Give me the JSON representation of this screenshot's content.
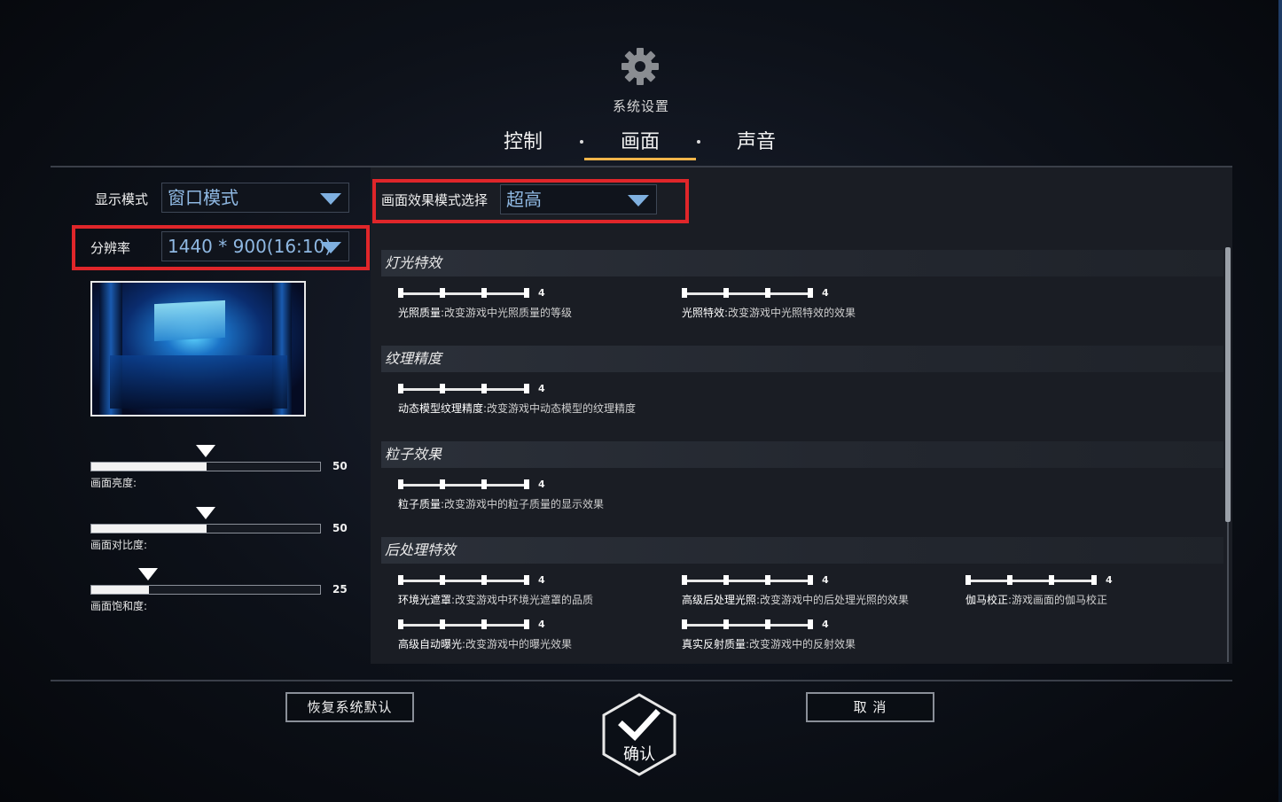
{
  "header": {
    "icon": "gear-icon",
    "title": "系统设置",
    "tabs": [
      {
        "label": "控制",
        "active": false
      },
      {
        "label": "画面",
        "active": true
      },
      {
        "label": "声音",
        "active": false
      }
    ],
    "accent_color": "#f1b54a"
  },
  "left": {
    "display_mode": {
      "label": "显示模式",
      "value": "窗口模式"
    },
    "resolution": {
      "label": "分辨率",
      "value": "1440 * 900(16:10)"
    },
    "sliders": [
      {
        "label": "画面亮度:",
        "value": "50",
        "fraction": 0.5
      },
      {
        "label": "画面对比度:",
        "value": "50",
        "fraction": 0.5
      },
      {
        "label": "画面饱和度:",
        "value": "25",
        "fraction": 0.25
      }
    ]
  },
  "right": {
    "quality_mode": {
      "label": "画面效果模式选择",
      "value": "超高"
    },
    "sections": [
      {
        "title": "灯光特效",
        "settings": [
          {
            "value": "4",
            "name": "光照质量",
            "desc": ":改变游戏中光照质量的等级"
          },
          {
            "value": "4",
            "name": "光照特效",
            "desc": ":改变游戏中光照特效的效果"
          }
        ]
      },
      {
        "title": "纹理精度",
        "settings": [
          {
            "value": "4",
            "name": "动态模型纹理精度",
            "desc": ":改变游戏中动态模型的纹理精度"
          }
        ]
      },
      {
        "title": "粒子效果",
        "settings": [
          {
            "value": "4",
            "name": "粒子质量",
            "desc": ":改变游戏中的粒子质量的显示效果"
          }
        ]
      },
      {
        "title": "后处理特效",
        "settings": [
          {
            "value": "4",
            "name": "环境光遮罩",
            "desc": ":改变游戏中环境光遮罩的品质"
          },
          {
            "value": "4",
            "name": "高级后处理光照",
            "desc": ":改变游戏中的后处理光照的效果"
          },
          {
            "value": "4",
            "name": "伽马校正",
            "desc": ":游戏画面的伽马校正"
          },
          {
            "value": "4",
            "name": "高级自动曝光",
            "desc": ":改变游戏中的曝光效果"
          },
          {
            "value": "4",
            "name": "真实反射质量",
            "desc": ":改变游戏中的反射效果"
          }
        ]
      }
    ]
  },
  "footer": {
    "reset_label": "恢复系统默认",
    "cancel_label": "取 消",
    "confirm_label": "确认",
    "confirm_icon": "checkmark-icon"
  },
  "highlight_color": "#e0262a"
}
